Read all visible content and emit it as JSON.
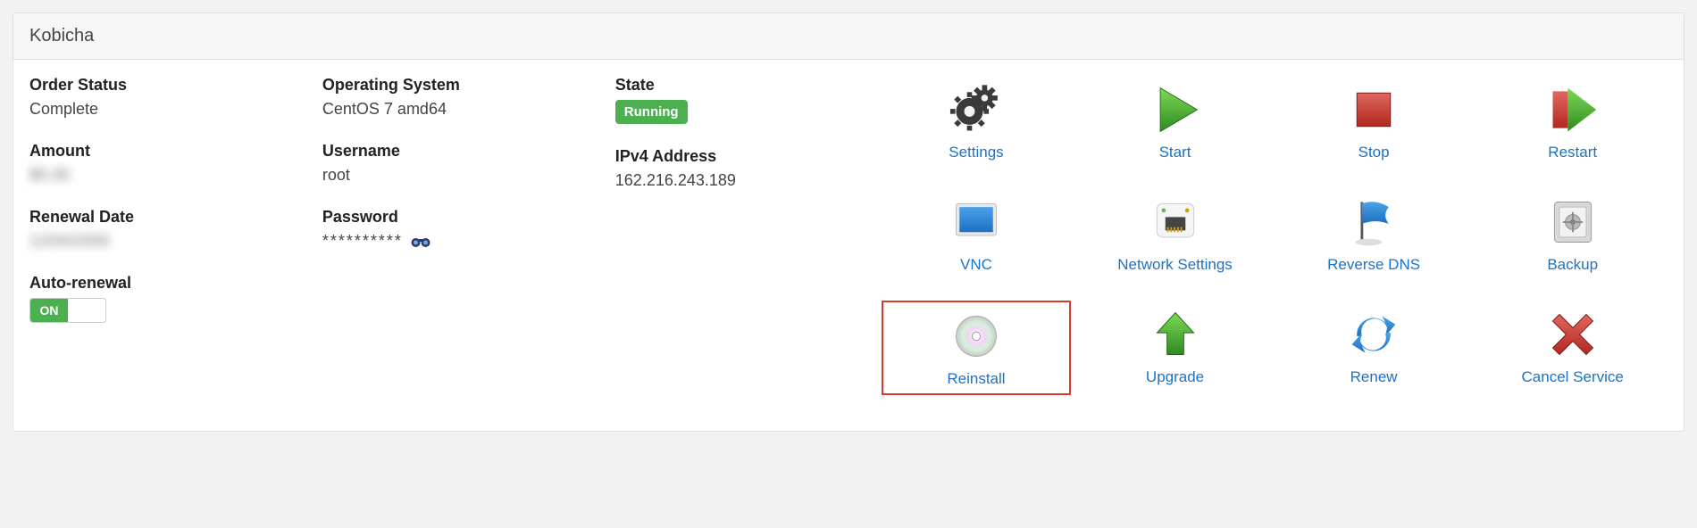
{
  "header": {
    "title": "Kobicha"
  },
  "info": {
    "order_status": {
      "label": "Order Status",
      "value": "Complete"
    },
    "amount": {
      "label": "Amount",
      "value": "$5.00"
    },
    "renewal_date": {
      "label": "Renewal Date",
      "value": "12/04/2050"
    },
    "auto_renewal": {
      "label": "Auto-renewal",
      "toggle_on": "ON"
    },
    "os": {
      "label": "Operating System",
      "value": "CentOS 7 amd64"
    },
    "username": {
      "label": "Username",
      "value": "root"
    },
    "password": {
      "label": "Password",
      "value": "**********"
    },
    "state": {
      "label": "State",
      "badge": "Running"
    },
    "ipv4": {
      "label": "IPv4 Address",
      "value": "162.216.243.189"
    }
  },
  "actions": [
    {
      "id": "settings",
      "label": "Settings",
      "icon": "gears"
    },
    {
      "id": "start",
      "label": "Start",
      "icon": "play-green"
    },
    {
      "id": "stop",
      "label": "Stop",
      "icon": "square-red"
    },
    {
      "id": "restart",
      "label": "Restart",
      "icon": "restart"
    },
    {
      "id": "vnc",
      "label": "VNC",
      "icon": "monitor"
    },
    {
      "id": "network",
      "label": "Network Settings",
      "icon": "ethernet"
    },
    {
      "id": "rdns",
      "label": "Reverse DNS",
      "icon": "flag"
    },
    {
      "id": "backup",
      "label": "Backup",
      "icon": "safe"
    },
    {
      "id": "reinstall",
      "label": "Reinstall",
      "icon": "disc",
      "highlight": true
    },
    {
      "id": "upgrade",
      "label": "Upgrade",
      "icon": "arrow-up"
    },
    {
      "id": "renew",
      "label": "Renew",
      "icon": "cycle"
    },
    {
      "id": "cancel",
      "label": "Cancel Service",
      "icon": "x-red"
    }
  ]
}
